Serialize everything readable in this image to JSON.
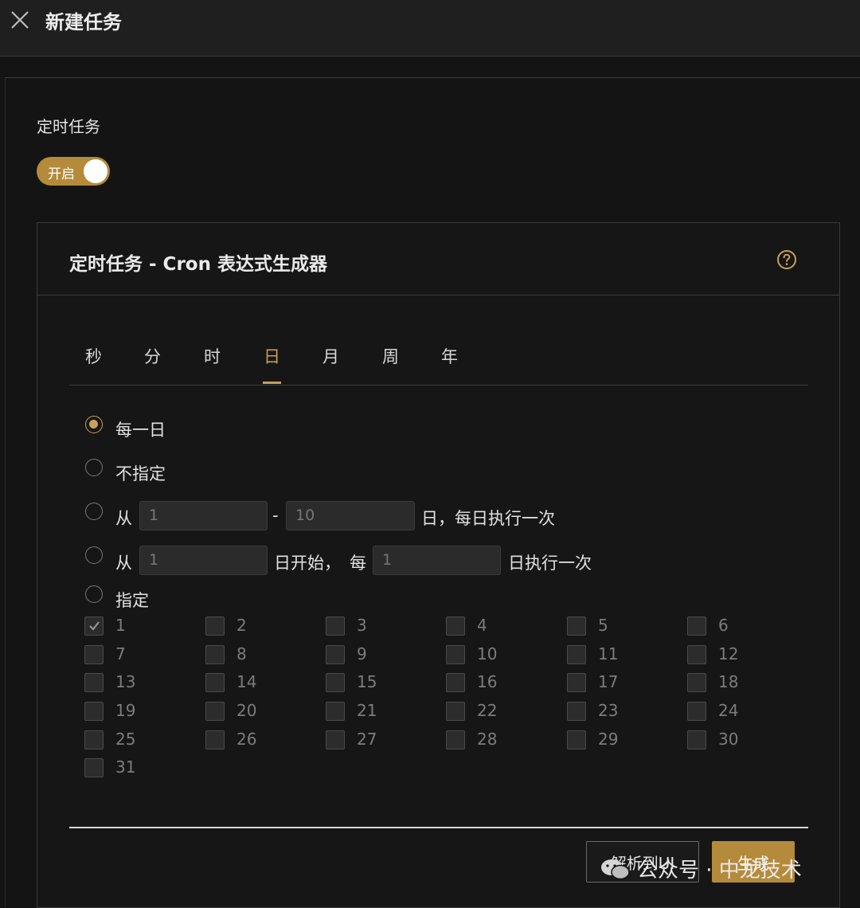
{
  "window": {
    "title": "新建任务"
  },
  "schedule": {
    "label": "定时任务",
    "switch_label": "开启",
    "enabled": true
  },
  "cron_card": {
    "title": "定时任务 - Cron 表达式生成器",
    "tabs": [
      "秒",
      "分",
      "时",
      "日",
      "月",
      "周",
      "年"
    ],
    "active_tab": "日"
  },
  "options": {
    "every_day": "每一日",
    "unspecified": "不指定",
    "range": {
      "from_label": "从",
      "start_value": "1",
      "dash": "-",
      "end_value": "10",
      "suffix": "日，每日执行一次"
    },
    "interval": {
      "from_label": "从",
      "start_value": "1",
      "mid_label": "日开始，",
      "every_label": "每",
      "step_value": "1",
      "suffix": "日执行一次"
    },
    "specific": "指定"
  },
  "days": [
    "1",
    "2",
    "3",
    "4",
    "5",
    "6",
    "7",
    "8",
    "9",
    "10",
    "11",
    "12",
    "13",
    "14",
    "15",
    "16",
    "17",
    "18",
    "19",
    "20",
    "21",
    "22",
    "23",
    "24",
    "25",
    "26",
    "27",
    "28",
    "29",
    "30",
    "31"
  ],
  "checked_days": [
    "1"
  ],
  "buttons": {
    "parse": "解析到UI",
    "generate": "生成"
  },
  "watermark": {
    "text": "公众号 · 中龙技术"
  },
  "colors": {
    "accent": "#b48a3b",
    "background": "#141414"
  }
}
